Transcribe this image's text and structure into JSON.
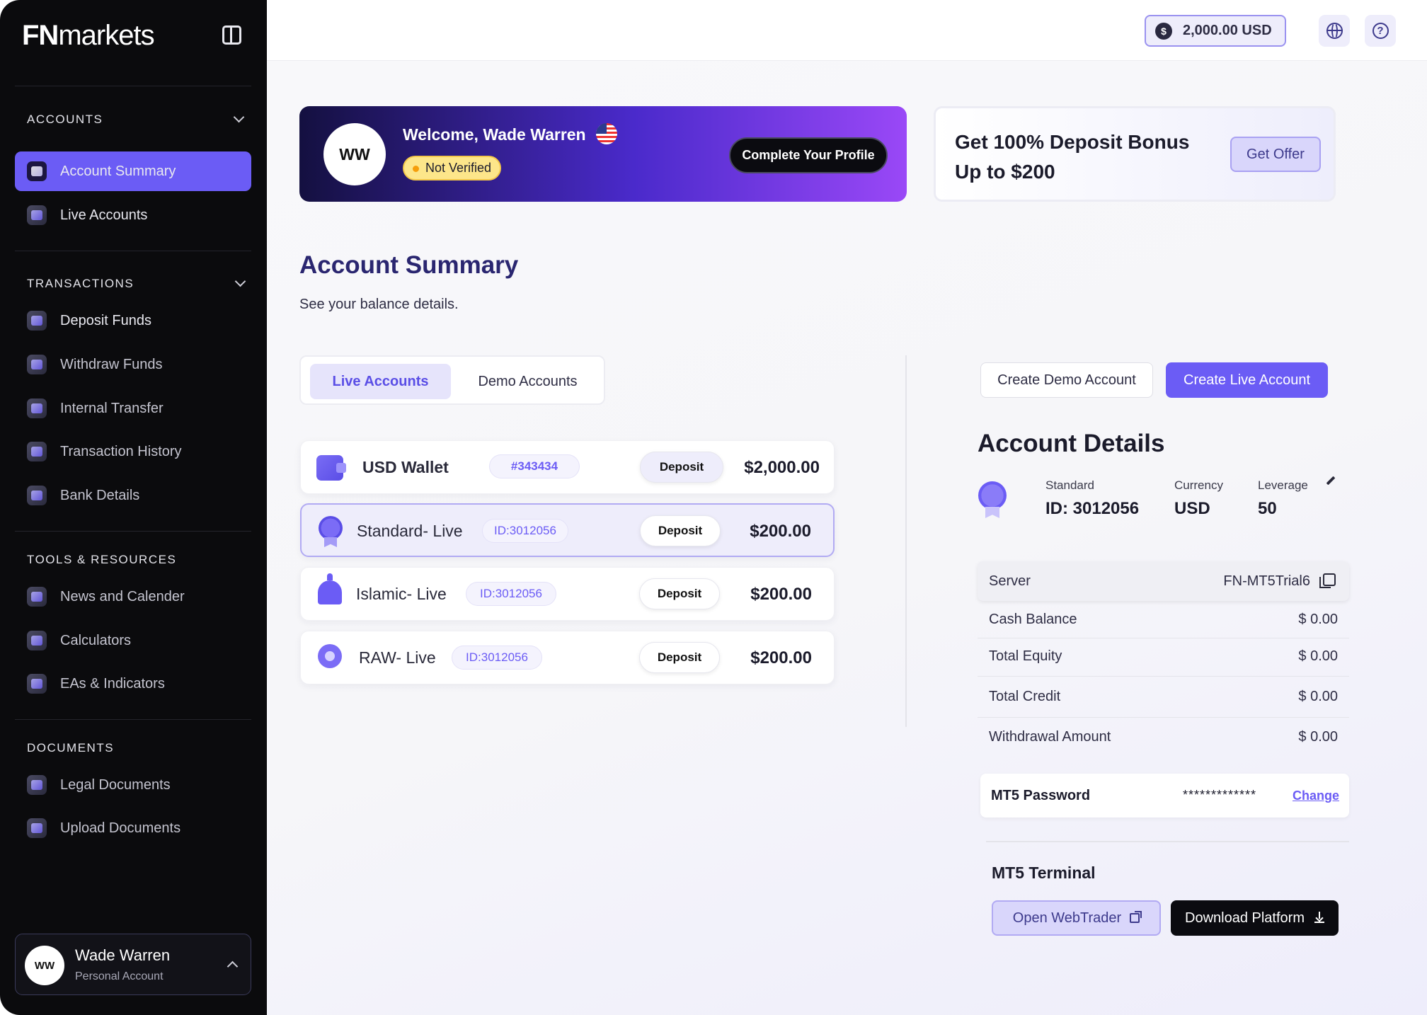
{
  "sidebar": {
    "logo_bold": "FN",
    "logo_rest": "markets",
    "sections": {
      "accounts": "ACCOUNTS",
      "transactions": "TRANSACTIONS",
      "tools": "TOOLS & RESOURCES",
      "documents": "DOCUMENTS"
    },
    "accounts_items": [
      {
        "label": "Account Summary",
        "icon": "account-summary-icon",
        "active": true
      },
      {
        "label": "Live Accounts",
        "icon": "user-icon"
      }
    ],
    "transactions_items": [
      {
        "label": "Deposit Funds",
        "icon": "deposit-icon"
      },
      {
        "label": "Withdraw Funds",
        "icon": "withdraw-icon"
      },
      {
        "label": "Internal Transfer",
        "icon": "transfer-icon"
      },
      {
        "label": "Transaction History",
        "icon": "history-icon"
      },
      {
        "label": "Bank Details",
        "icon": "bank-icon"
      }
    ],
    "tools_items": [
      {
        "label": "News and Calender",
        "icon": "calendar-icon"
      },
      {
        "label": "Calculators",
        "icon": "calculator-icon"
      },
      {
        "label": "EAs & Indicators",
        "icon": "indicator-icon"
      }
    ],
    "documents_items": [
      {
        "label": "Legal Documents",
        "icon": "legal-icon"
      },
      {
        "label": "Upload Documents",
        "icon": "upload-icon"
      }
    ],
    "user": {
      "initials": "WW",
      "name": "Wade Warren",
      "type": "Personal Account"
    }
  },
  "topbar": {
    "balance_symbol": "$",
    "balance": "2,000.00 USD",
    "help_symbol": "?"
  },
  "welcome": {
    "initials": "WW",
    "title": "Welcome, Wade Warren",
    "status": "Not Verified",
    "cta": "Complete Your Profile"
  },
  "bonus": {
    "text": "Get 100% Deposit Bonus Up to $200",
    "cta": "Get Offer"
  },
  "page": {
    "title": "Account Summary",
    "subtitle": "See your balance details."
  },
  "tabs": [
    "Live Accounts",
    "Demo Accounts"
  ],
  "accounts": [
    {
      "name": "USD Wallet",
      "id": "#343434",
      "action": "Deposit",
      "amount": "$2,000.00",
      "icon": "wallet-icon"
    },
    {
      "name": "Standard- Live",
      "id": "ID:3012056",
      "action": "Deposit",
      "amount": "$200.00",
      "icon": "badge-icon"
    },
    {
      "name": "Islamic- Live",
      "id": "ID:3012056",
      "action": "Deposit",
      "amount": "$200.00",
      "icon": "mosque-icon"
    },
    {
      "name": "RAW- Live",
      "id": "ID:3012056",
      "action": "Deposit",
      "amount": "$200.00",
      "icon": "money-bag-icon"
    }
  ],
  "right": {
    "create_demo": "Create Demo Account",
    "create_live": "Create Live Account",
    "details_title": "Account Details",
    "standard_label": "Standard",
    "standard_value": "ID: 3012056",
    "currency_label": "Currency",
    "currency_value": "USD",
    "leverage_label": "Leverage",
    "leverage_value": "50",
    "server_label": "Server",
    "server_value": "FN-MT5Trial6",
    "stats": [
      {
        "label": "Cash Balance",
        "value": "$ 0.00"
      },
      {
        "label": "Total Equity",
        "value": "$ 0.00"
      },
      {
        "label": "Total Credit",
        "value": "$ 0.00"
      },
      {
        "label": "Withdrawal Amount",
        "value": "$ 0.00"
      }
    ],
    "mt5_password_label": "MT5 Password",
    "mt5_password_value": "*************",
    "mt5_password_change": "Change",
    "terminal_title": "MT5 Terminal",
    "open_webtrader": "Open WebTrader",
    "download_platform": "Download Platform"
  }
}
